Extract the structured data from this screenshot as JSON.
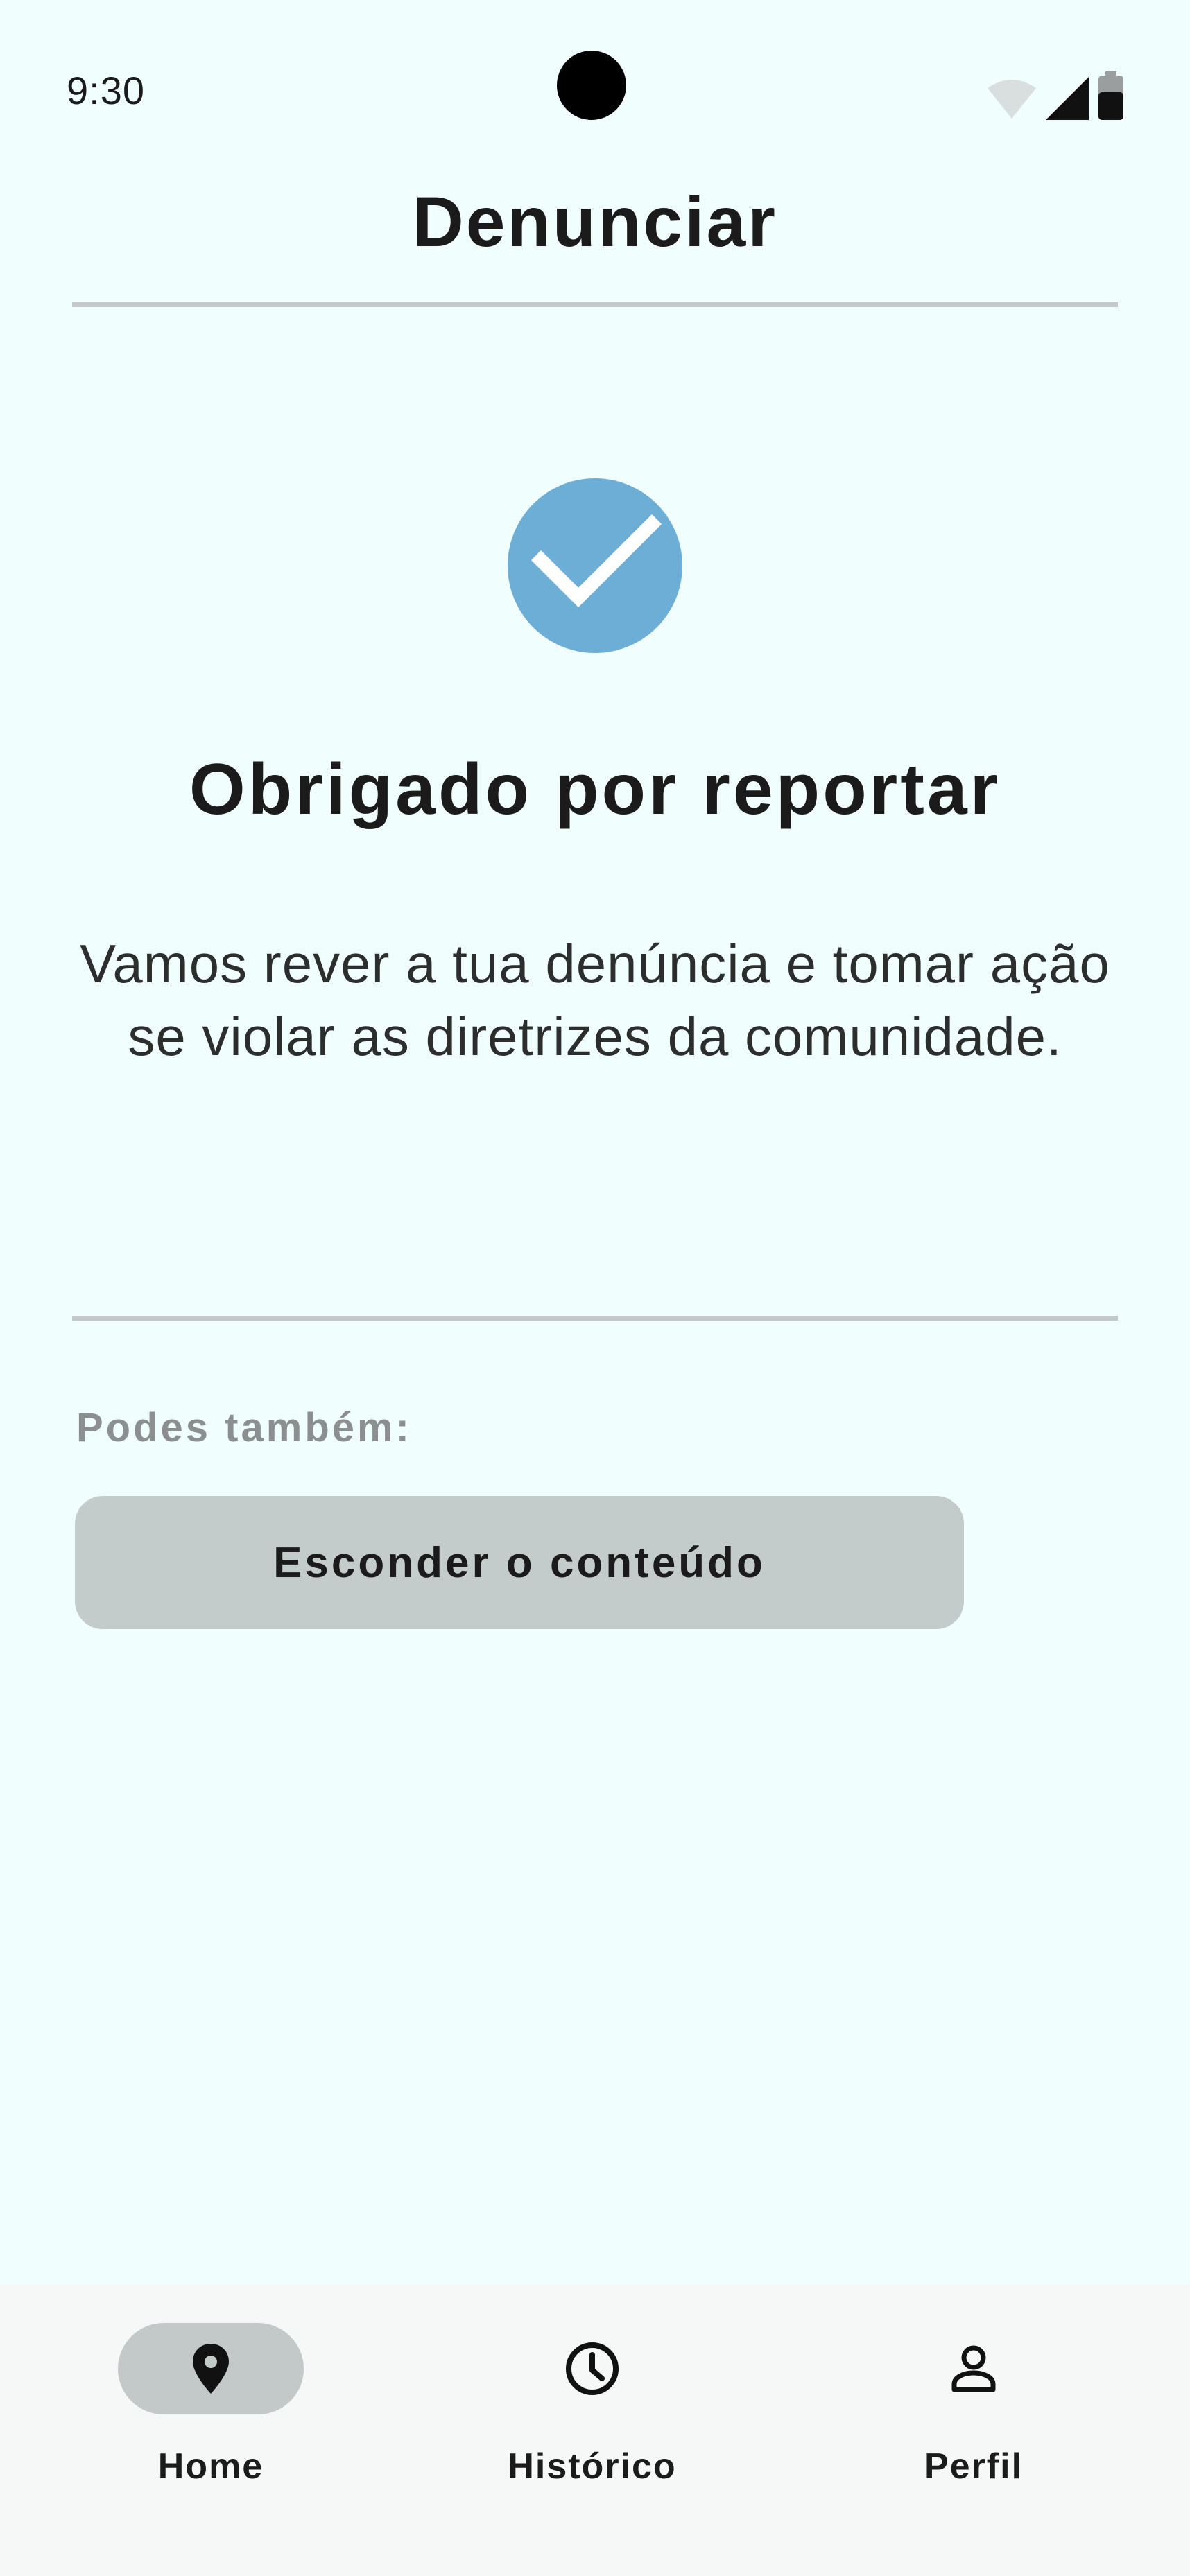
{
  "status_bar": {
    "time": "9:30",
    "icons": [
      "wifi-icon",
      "cellular-signal-icon",
      "battery-icon"
    ]
  },
  "header": {
    "title": "Denunciar"
  },
  "confirmation": {
    "icon": "check-icon",
    "title": "Obrigado por reportar",
    "message": "Vamos rever a tua denúncia e tomar ação se violar as diretrizes da comunidade."
  },
  "options": {
    "label": "Podes também:",
    "hide_button_label": "Esconder o conteúdo"
  },
  "bottom_nav": {
    "items": [
      {
        "label": "Home",
        "icon": "location-pin-icon",
        "active": true
      },
      {
        "label": "Histórico",
        "icon": "clock-icon",
        "active": false
      },
      {
        "label": "Perfil",
        "icon": "person-icon",
        "active": false
      }
    ]
  },
  "colors": {
    "background": "#f1fefe",
    "accent": "#6daed7",
    "button": "#c3cbcb",
    "active_nav_pill": "#c3c9c9",
    "nav_background": "#f6f7f7"
  }
}
